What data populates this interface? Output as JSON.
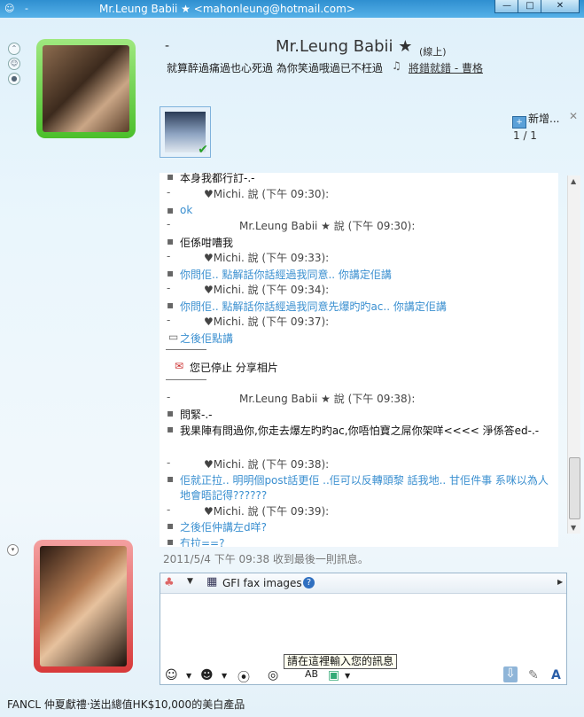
{
  "window": {
    "title": "Mr.Leung Babii ★ <mahonleung@hotmail.com>",
    "dash": "-",
    "minimize": "—",
    "maximize": "□",
    "close": "✕"
  },
  "contact": {
    "dash": "-",
    "name": "Mr.Leung Babii ★",
    "status": "(線上)",
    "psm": "就算醉過痛過也心死過 為你笑過哦過已不枉過",
    "music_link": "將錯就錯 - 曹格"
  },
  "sharing": {
    "add_label": "新增...",
    "close": "✕",
    "page": "1 / 1"
  },
  "chat": {
    "lines": [
      {
        "kind": "text",
        "bullet": "▪",
        "text": "本身我都行訂-.-",
        "color": "black"
      },
      {
        "kind": "sender",
        "bullet": "-",
        "text": "♥Michi. 說 (下午 09:30):"
      },
      {
        "kind": "text",
        "bullet": "▪",
        "text": "ok",
        "color": "blue"
      },
      {
        "kind": "sender",
        "bullet": "-",
        "text": "Mr.Leung Babii ★ 說 (下午 09:30):",
        "me": true
      },
      {
        "kind": "text",
        "bullet": "▪",
        "text": "佢係咁嘈我",
        "color": "black"
      },
      {
        "kind": "sender",
        "bullet": "-",
        "text": "♥Michi. 說 (下午 09:33):"
      },
      {
        "kind": "text",
        "bullet": "▪",
        "text": "你問佢.. 點解話你話經過我同意.. 你講定佢講",
        "color": "blue"
      },
      {
        "kind": "sender",
        "bullet": "-",
        "text": "♥Michi. 說 (下午 09:34):"
      },
      {
        "kind": "text",
        "bullet": "▪",
        "text": "你問佢.. 點解話你話經過我同意先爆旳旳ac.. 你講定佢講",
        "color": "blue"
      },
      {
        "kind": "sender",
        "bullet": "-",
        "text": "♥Michi. 說 (下午 09:37):"
      },
      {
        "kind": "text",
        "bullet": "▭",
        "text": "之後佢點講",
        "color": "blue"
      },
      {
        "kind": "notice",
        "text": "您已停止 分享相片"
      },
      {
        "kind": "sender",
        "bullet": "-",
        "text": "Mr.Leung Babii ★ 說 (下午 09:38):",
        "me": true
      },
      {
        "kind": "text",
        "bullet": "▪",
        "text": "問緊-.-",
        "color": "black"
      },
      {
        "kind": "text",
        "bullet": "▪",
        "text": "我果陣有問過你,你走去爆左旳旳ac,你唔怕寶之屌你架咩<<<< 淨係答ed-.-",
        "color": "black"
      },
      {
        "kind": "sender",
        "bullet": "-",
        "text": "♥Michi. 說 (下午 09:38):"
      },
      {
        "kind": "text",
        "bullet": "▪",
        "text": "佢就正拉.. 明明個post話更佢 ..佢可以反轉頭黎 話我地.. 甘佢件事 系咪以為人",
        "color": "blue"
      },
      {
        "kind": "cont",
        "text": "地會晤記得??????",
        "color": "blue"
      },
      {
        "kind": "sender",
        "bullet": "-",
        "text": "♥Michi. 說 (下午 09:39):"
      },
      {
        "kind": "text",
        "bullet": "▪",
        "text": "之後佢仲講左d咩?",
        "color": "blue"
      },
      {
        "kind": "text",
        "bullet": "▪",
        "text": "冇拉==?",
        "color": "blue"
      }
    ]
  },
  "last_message": "2011/5/4 下午 09:38 收到最後一則訊息。",
  "input": {
    "fax_label": "GFI fax images",
    "help": "?",
    "tooltip": "請在這裡輸入您的訊息"
  },
  "footer": "FANCL 仲夏獻禮‧送出總值HK$10,000的美白產品"
}
